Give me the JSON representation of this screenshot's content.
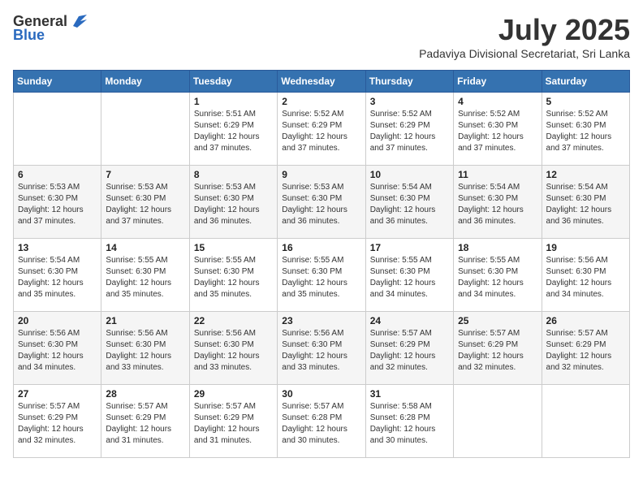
{
  "logo": {
    "general": "General",
    "blue": "Blue"
  },
  "title": {
    "month": "July 2025",
    "location": "Padaviya Divisional Secretariat, Sri Lanka"
  },
  "weekdays": [
    "Sunday",
    "Monday",
    "Tuesday",
    "Wednesday",
    "Thursday",
    "Friday",
    "Saturday"
  ],
  "weeks": [
    [
      {
        "day": "",
        "info": ""
      },
      {
        "day": "",
        "info": ""
      },
      {
        "day": "1",
        "info": "Sunrise: 5:51 AM\nSunset: 6:29 PM\nDaylight: 12 hours and 37 minutes."
      },
      {
        "day": "2",
        "info": "Sunrise: 5:52 AM\nSunset: 6:29 PM\nDaylight: 12 hours and 37 minutes."
      },
      {
        "day": "3",
        "info": "Sunrise: 5:52 AM\nSunset: 6:29 PM\nDaylight: 12 hours and 37 minutes."
      },
      {
        "day": "4",
        "info": "Sunrise: 5:52 AM\nSunset: 6:30 PM\nDaylight: 12 hours and 37 minutes."
      },
      {
        "day": "5",
        "info": "Sunrise: 5:52 AM\nSunset: 6:30 PM\nDaylight: 12 hours and 37 minutes."
      }
    ],
    [
      {
        "day": "6",
        "info": "Sunrise: 5:53 AM\nSunset: 6:30 PM\nDaylight: 12 hours and 37 minutes."
      },
      {
        "day": "7",
        "info": "Sunrise: 5:53 AM\nSunset: 6:30 PM\nDaylight: 12 hours and 37 minutes."
      },
      {
        "day": "8",
        "info": "Sunrise: 5:53 AM\nSunset: 6:30 PM\nDaylight: 12 hours and 36 minutes."
      },
      {
        "day": "9",
        "info": "Sunrise: 5:53 AM\nSunset: 6:30 PM\nDaylight: 12 hours and 36 minutes."
      },
      {
        "day": "10",
        "info": "Sunrise: 5:54 AM\nSunset: 6:30 PM\nDaylight: 12 hours and 36 minutes."
      },
      {
        "day": "11",
        "info": "Sunrise: 5:54 AM\nSunset: 6:30 PM\nDaylight: 12 hours and 36 minutes."
      },
      {
        "day": "12",
        "info": "Sunrise: 5:54 AM\nSunset: 6:30 PM\nDaylight: 12 hours and 36 minutes."
      }
    ],
    [
      {
        "day": "13",
        "info": "Sunrise: 5:54 AM\nSunset: 6:30 PM\nDaylight: 12 hours and 35 minutes."
      },
      {
        "day": "14",
        "info": "Sunrise: 5:55 AM\nSunset: 6:30 PM\nDaylight: 12 hours and 35 minutes."
      },
      {
        "day": "15",
        "info": "Sunrise: 5:55 AM\nSunset: 6:30 PM\nDaylight: 12 hours and 35 minutes."
      },
      {
        "day": "16",
        "info": "Sunrise: 5:55 AM\nSunset: 6:30 PM\nDaylight: 12 hours and 35 minutes."
      },
      {
        "day": "17",
        "info": "Sunrise: 5:55 AM\nSunset: 6:30 PM\nDaylight: 12 hours and 34 minutes."
      },
      {
        "day": "18",
        "info": "Sunrise: 5:55 AM\nSunset: 6:30 PM\nDaylight: 12 hours and 34 minutes."
      },
      {
        "day": "19",
        "info": "Sunrise: 5:56 AM\nSunset: 6:30 PM\nDaylight: 12 hours and 34 minutes."
      }
    ],
    [
      {
        "day": "20",
        "info": "Sunrise: 5:56 AM\nSunset: 6:30 PM\nDaylight: 12 hours and 34 minutes."
      },
      {
        "day": "21",
        "info": "Sunrise: 5:56 AM\nSunset: 6:30 PM\nDaylight: 12 hours and 33 minutes."
      },
      {
        "day": "22",
        "info": "Sunrise: 5:56 AM\nSunset: 6:30 PM\nDaylight: 12 hours and 33 minutes."
      },
      {
        "day": "23",
        "info": "Sunrise: 5:56 AM\nSunset: 6:30 PM\nDaylight: 12 hours and 33 minutes."
      },
      {
        "day": "24",
        "info": "Sunrise: 5:57 AM\nSunset: 6:29 PM\nDaylight: 12 hours and 32 minutes."
      },
      {
        "day": "25",
        "info": "Sunrise: 5:57 AM\nSunset: 6:29 PM\nDaylight: 12 hours and 32 minutes."
      },
      {
        "day": "26",
        "info": "Sunrise: 5:57 AM\nSunset: 6:29 PM\nDaylight: 12 hours and 32 minutes."
      }
    ],
    [
      {
        "day": "27",
        "info": "Sunrise: 5:57 AM\nSunset: 6:29 PM\nDaylight: 12 hours and 32 minutes."
      },
      {
        "day": "28",
        "info": "Sunrise: 5:57 AM\nSunset: 6:29 PM\nDaylight: 12 hours and 31 minutes."
      },
      {
        "day": "29",
        "info": "Sunrise: 5:57 AM\nSunset: 6:29 PM\nDaylight: 12 hours and 31 minutes."
      },
      {
        "day": "30",
        "info": "Sunrise: 5:57 AM\nSunset: 6:28 PM\nDaylight: 12 hours and 30 minutes."
      },
      {
        "day": "31",
        "info": "Sunrise: 5:58 AM\nSunset: 6:28 PM\nDaylight: 12 hours and 30 minutes."
      },
      {
        "day": "",
        "info": ""
      },
      {
        "day": "",
        "info": ""
      }
    ]
  ]
}
